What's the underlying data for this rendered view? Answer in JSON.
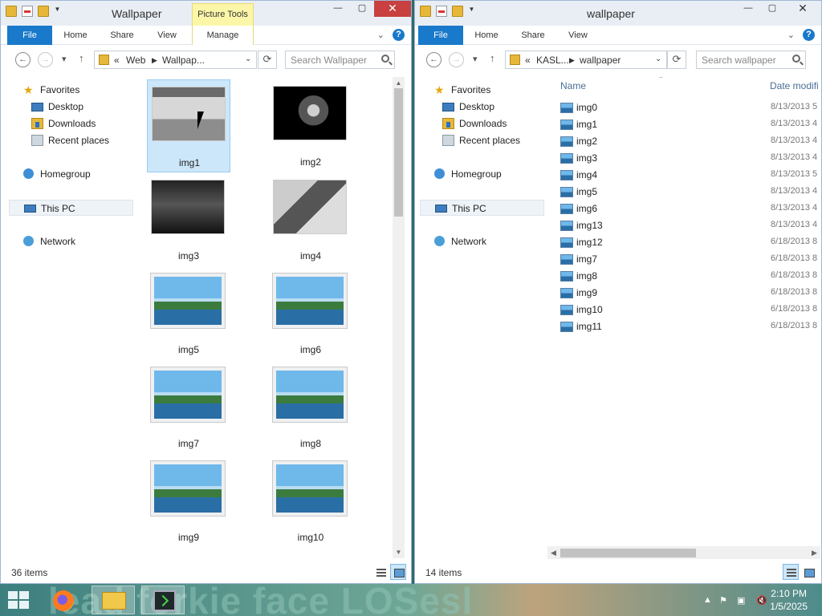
{
  "left_window": {
    "title": "Wallpaper",
    "context_tab": "Picture Tools",
    "ribbon_tabs": [
      "File",
      "Home",
      "Share",
      "View",
      "Manage"
    ],
    "address": {
      "overflow": "«",
      "crumbs": [
        "Web",
        "Wallpap..."
      ]
    },
    "search_placeholder": "Search Wallpaper",
    "nav_pane": {
      "favorites": "Favorites",
      "desktop": "Desktop",
      "downloads": "Downloads",
      "recent": "Recent places",
      "homegroup": "Homegroup",
      "this_pc": "This PC",
      "network": "Network"
    },
    "items": [
      "img1",
      "img2",
      "img3",
      "img4",
      "img5",
      "img6",
      "img7",
      "img8",
      "img9",
      "img10"
    ],
    "status": "36 items"
  },
  "right_window": {
    "title": "wallpaper",
    "ribbon_tabs": [
      "File",
      "Home",
      "Share",
      "View"
    ],
    "address": {
      "overflow": "«",
      "crumbs": [
        "KASL...",
        "wallpaper"
      ]
    },
    "search_placeholder": "Search wallpaper",
    "nav_pane": {
      "favorites": "Favorites",
      "desktop": "Desktop",
      "downloads": "Downloads",
      "recent": "Recent places",
      "homegroup": "Homegroup",
      "this_pc": "This PC",
      "network": "Network"
    },
    "columns": {
      "name": "Name",
      "date": "Date modifi"
    },
    "files": [
      {
        "name": "img0",
        "date": "8/13/2013 5"
      },
      {
        "name": "img1",
        "date": "8/13/2013 4"
      },
      {
        "name": "img2",
        "date": "8/13/2013 4"
      },
      {
        "name": "img3",
        "date": "8/13/2013 4"
      },
      {
        "name": "img4",
        "date": "8/13/2013 5"
      },
      {
        "name": "img5",
        "date": "8/13/2013 4"
      },
      {
        "name": "img6",
        "date": "8/13/2013 4"
      },
      {
        "name": "img13",
        "date": "8/13/2013 4"
      },
      {
        "name": "img12",
        "date": "6/18/2013 8"
      },
      {
        "name": "img7",
        "date": "6/18/2013 8"
      },
      {
        "name": "img8",
        "date": "6/18/2013 8"
      },
      {
        "name": "img9",
        "date": "6/18/2013 8"
      },
      {
        "name": "img10",
        "date": "6/18/2013 8"
      },
      {
        "name": "img11",
        "date": "6/18/2013 8"
      }
    ],
    "status": "14 items"
  },
  "taskbar": {
    "wallpaper_text": "lead forkie face LOSesl",
    "clock_time": "2:10 PM",
    "clock_date": "1/5/2025"
  }
}
